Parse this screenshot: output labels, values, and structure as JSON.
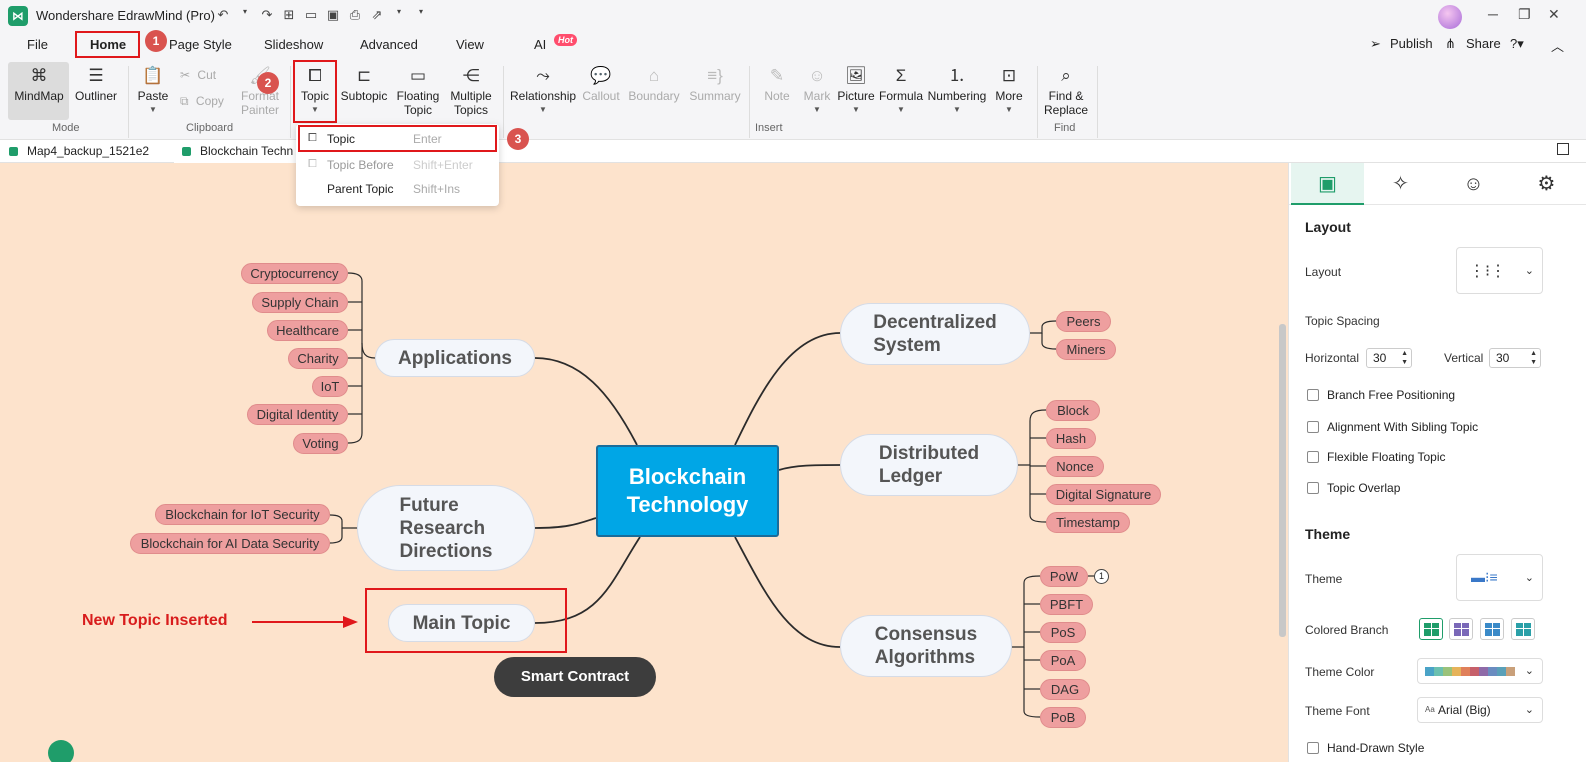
{
  "app": {
    "title": "Wondershare EdrawMind (Pro)",
    "logo": "edrawmind-logo-icon"
  },
  "menu": {
    "items": [
      "File",
      "Home",
      "Page Style",
      "Slideshow",
      "Advanced",
      "View",
      "AI"
    ],
    "hot_badge": "Hot",
    "publish": "Publish",
    "share": "Share"
  },
  "steps": [
    "1",
    "2",
    "3"
  ],
  "ribbon": {
    "mode": {
      "mindmap": "MindMap",
      "outliner": "Outliner",
      "label": "Mode"
    },
    "clipboard": {
      "paste": "Paste",
      "cut": "Cut",
      "copy": "Copy",
      "format_painter_1": "Format",
      "format_painter_2": "Painter",
      "label": "Clipboard"
    },
    "insert": {
      "topic": "Topic",
      "subtopic": "Subtopic",
      "floating_1": "Floating",
      "floating_2": "Topic",
      "multiple_1": "Multiple",
      "multiple_2": "Topics",
      "relationship": "Relationship",
      "callout": "Callout",
      "boundary": "Boundary",
      "summary": "Summary",
      "note": "Note",
      "mark": "Mark",
      "picture": "Picture",
      "formula": "Formula",
      "numbering": "Numbering",
      "more": "More",
      "label": "Insert"
    },
    "find": {
      "line1": "Find &",
      "line2": "Replace",
      "label": "Find"
    }
  },
  "dropdown": {
    "items": [
      {
        "label": "Topic",
        "shortcut": "Enter"
      },
      {
        "label": "Topic Before",
        "shortcut": "Shift+Enter"
      },
      {
        "label": "Parent Topic",
        "shortcut": "Shift+Ins"
      }
    ]
  },
  "doc_tabs": [
    "Map4_backup_1521e2",
    "Blockchain Techn"
  ],
  "mindmap": {
    "center_1": "Blockchain",
    "center_2": "Technology",
    "applications": "Applications",
    "app_children": [
      "Cryptocurrency",
      "Supply Chain",
      "Healthcare",
      "Charity",
      "IoT",
      "Digital Identity",
      "Voting"
    ],
    "future_1": "Future",
    "future_2": "Research",
    "future_3": "Directions",
    "future_children": [
      "Blockchain for IoT Security",
      "Blockchain for AI Data Security"
    ],
    "main_topic": "Main Topic",
    "smart_contract": "Smart Contract",
    "decentral_1": "Decentralized",
    "decentral_2": "System",
    "decentral_children": [
      "Peers",
      "Miners"
    ],
    "ledger_1": "Distributed",
    "ledger_2": "Ledger",
    "ledger_children": [
      "Block",
      "Hash",
      "Nonce",
      "Digital Signature",
      "Timestamp"
    ],
    "consensus_1": "Consensus",
    "consensus_2": "Algorithms",
    "consensus_children": [
      "PoW",
      "PBFT",
      "PoS",
      "PoA",
      "DAG",
      "PoB"
    ],
    "pow_marker": "1",
    "annotation": "New Topic Inserted"
  },
  "panel": {
    "layout_heading": "Layout",
    "layout_label": "Layout",
    "topic_spacing": "Topic Spacing",
    "horizontal_label": "Horizontal",
    "horizontal_value": "30",
    "vertical_label": "Vertical",
    "vertical_value": "30",
    "checkboxes": [
      "Branch Free Positioning",
      "Alignment With Sibling Topic",
      "Flexible Floating Topic",
      "Topic Overlap"
    ],
    "theme_heading": "Theme",
    "theme_label": "Theme",
    "colored_branch": "Colored Branch",
    "theme_color": "Theme Color",
    "theme_font": "Theme Font",
    "theme_font_value": "Arial (Big)",
    "hand_drawn": "Hand-Drawn Style",
    "theme_colors": [
      "#4aa3c7",
      "#6bc0b0",
      "#9ac27a",
      "#e6b35a",
      "#e0805a",
      "#c65f6a",
      "#8e6aa8",
      "#6a8cc0",
      "#5aa0b8",
      "#c9a07a"
    ]
  },
  "colors": {
    "canvas": "#fde3cc",
    "center": "#00a6e6",
    "subtopic": "#ee9f9f",
    "accent": "#1f9d6a",
    "highlight": "#e0181b"
  }
}
